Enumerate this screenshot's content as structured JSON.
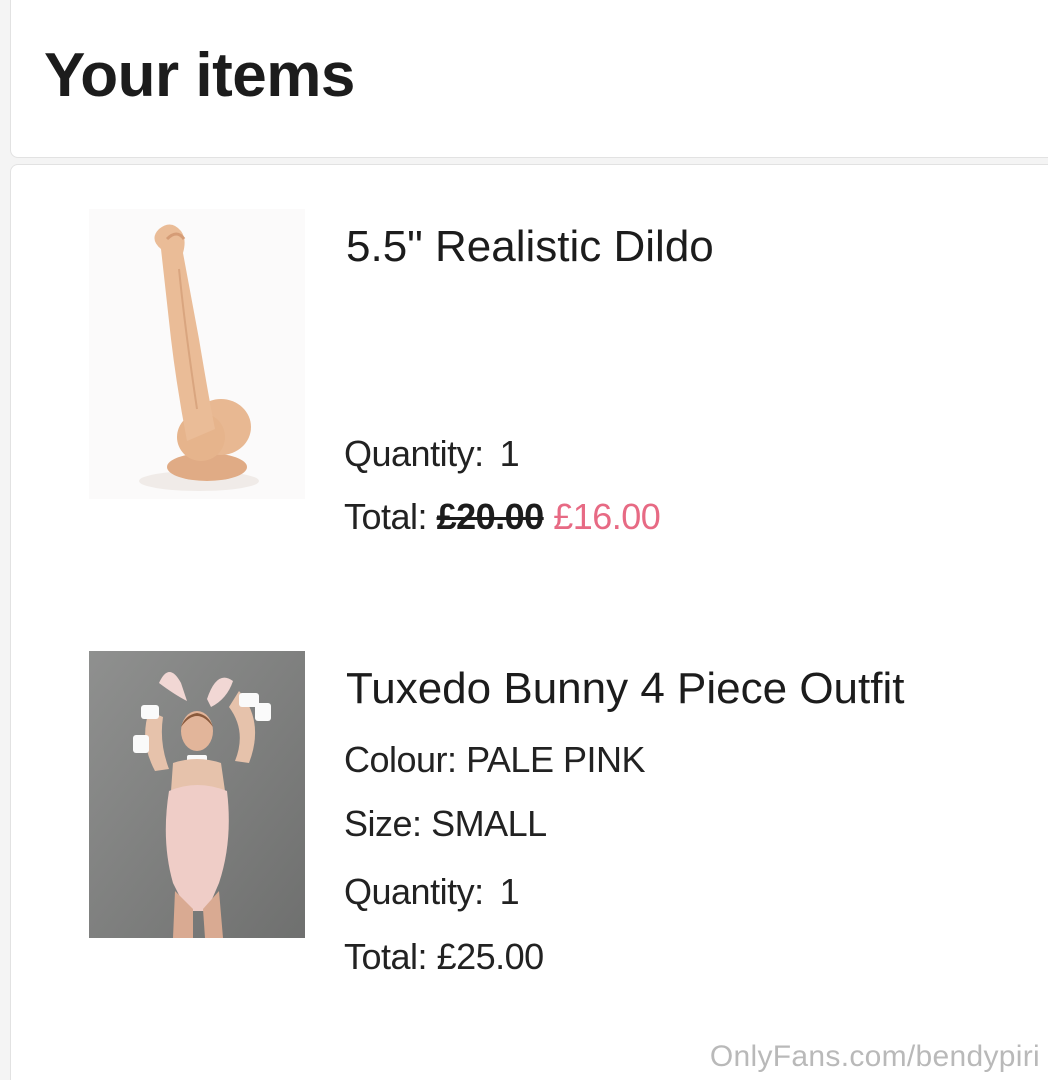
{
  "header": {
    "title": "Your items"
  },
  "items": [
    {
      "name": "5.5\" Realistic Dildo",
      "image_icon": "realistic-dildo-product-image",
      "quantity_label": "Quantity:",
      "quantity_value": "1",
      "total_label": "Total:",
      "price_original": "£20.00",
      "price_sale": "£16.00"
    },
    {
      "name": "Tuxedo Bunny 4 Piece Outfit",
      "image_icon": "bunny-outfit-product-image",
      "colour_label": "Colour:",
      "colour_value": "PALE PINK",
      "size_label": "Size:",
      "size_value": "SMALL",
      "quantity_label": "Quantity:",
      "quantity_value": "1",
      "total_label": "Total:",
      "price": "£25.00"
    }
  ],
  "watermark": "OnlyFans.com/bendypiri",
  "colors": {
    "sale_price": "#e76a84",
    "text": "#1c1c1c",
    "card_border": "#e2e2e2"
  }
}
